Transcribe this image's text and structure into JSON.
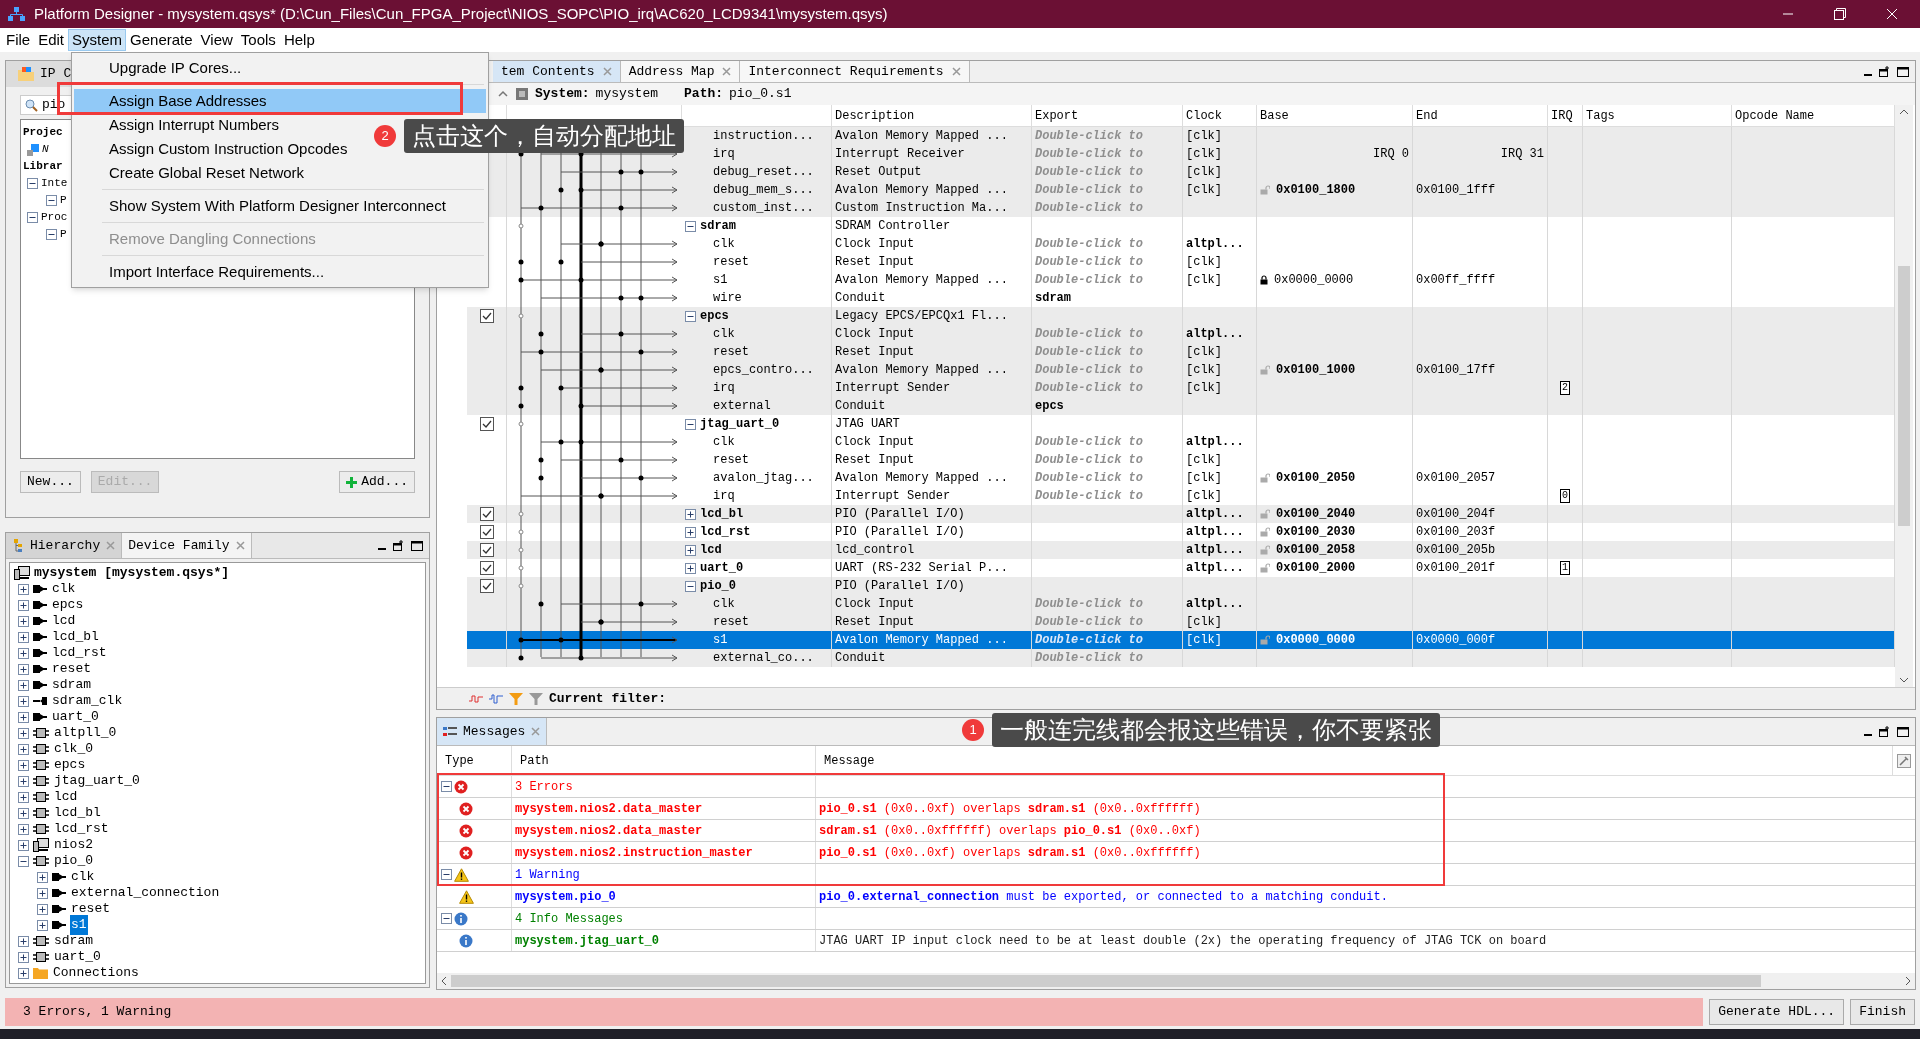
{
  "window": {
    "title": "Platform Designer - mysystem.qsys* (D:\\Cun_Files\\Cun_FPGA_Project\\NIOS_SOPC\\PIO_irq\\AC620_LCD9341\\mysystem.qsys)"
  },
  "menu_bar": [
    {
      "label": "File",
      "selected": false
    },
    {
      "label": "Edit",
      "selected": false
    },
    {
      "label": "System",
      "selected": true
    },
    {
      "label": "Generate",
      "selected": false
    },
    {
      "label": "View",
      "selected": false
    },
    {
      "label": "Tools",
      "selected": false
    },
    {
      "label": "Help",
      "selected": false
    }
  ],
  "system_menu": [
    {
      "kind": "item",
      "label": "Upgrade IP Cores...",
      "selected": false,
      "disabled": false
    },
    {
      "kind": "separator"
    },
    {
      "kind": "item",
      "label": "Assign Base Addresses",
      "selected": true,
      "disabled": false
    },
    {
      "kind": "item",
      "label": "Assign Interrupt Numbers",
      "selected": false,
      "disabled": false
    },
    {
      "kind": "item",
      "label": "Assign Custom Instruction Opcodes",
      "selected": false,
      "disabled": false
    },
    {
      "kind": "item",
      "label": "Create Global Reset Network",
      "selected": false,
      "disabled": false
    },
    {
      "kind": "separator"
    },
    {
      "kind": "item",
      "label": "Show System With Platform Designer Interconnect",
      "selected": false,
      "disabled": false
    },
    {
      "kind": "separator"
    },
    {
      "kind": "item",
      "label": "Remove Dangling Connections",
      "selected": false,
      "disabled": true
    },
    {
      "kind": "separator"
    },
    {
      "kind": "item",
      "label": "Import Interface Requirements...",
      "selected": false,
      "disabled": false
    }
  ],
  "ip_catalog": {
    "tab": "IP C",
    "search": "pio",
    "tree": [
      {
        "label": "Projec",
        "kind": "heading",
        "children": [
          {
            "label": "N",
            "kind": "component"
          }
        ]
      },
      {
        "label": "Librar",
        "kind": "heading",
        "children": [
          {
            "label": "Inte",
            "kind": "folder",
            "expanded": true,
            "children": [
              {
                "label": "P",
                "kind": "folder",
                "expanded": true
              }
            ]
          },
          {
            "label": "Proc",
            "kind": "folder",
            "expanded": true,
            "children": [
              {
                "label": "P",
                "kind": "folder",
                "expanded": true
              }
            ]
          }
        ]
      }
    ],
    "buttons": [
      {
        "label": "New...",
        "kind": "plain",
        "disabled": false
      },
      {
        "label": "Edit...",
        "kind": "plain",
        "disabled": true
      },
      {
        "label": "Add...",
        "kind": "add",
        "disabled": false
      }
    ]
  },
  "system_contents": {
    "tabs": [
      {
        "label": "tem Contents",
        "selected": true
      },
      {
        "label": "Address Map",
        "selected": false
      },
      {
        "label": "Interconnect Requirements",
        "selected": false
      }
    ],
    "path_bar": {
      "system_label": "System:",
      "system": "mysystem",
      "path_label": "Path:",
      "path": "pio_0.s1"
    },
    "columns": [
      "Description",
      "Export",
      "Clock",
      "Base",
      "End",
      "IRQ",
      "Tags",
      "Opcode Name"
    ],
    "rows": [
      {
        "kind": "port",
        "name": "instruction...",
        "description": "Avalon Memory Mapped ...",
        "export": "Double-click to",
        "export_hint": true,
        "clock": "[clk]",
        "selected": false
      },
      {
        "kind": "port",
        "name": "irq",
        "description": "Interrupt Receiver",
        "export": "Double-click to",
        "export_hint": true,
        "clock": "[clk]",
        "base": "IRQ 0",
        "end": "IRQ 31",
        "selected": false
      },
      {
        "kind": "port",
        "name": "debug_reset...",
        "description": "Reset Output",
        "export": "Double-click to",
        "export_hint": true,
        "clock": "[clk]",
        "selected": false
      },
      {
        "kind": "port",
        "name": "debug_mem_s...",
        "description": "Avalon Memory Mapped ...",
        "export": "Double-click to",
        "export_hint": true,
        "clock": "[clk]",
        "base": "0x0100_1800",
        "locked": false,
        "end": "0x0100_1fff",
        "selected": false
      },
      {
        "kind": "port",
        "name": "custom_inst...",
        "description": "Custom Instruction Ma...",
        "export": "Double-click to",
        "export_hint": true,
        "selected": false
      },
      {
        "kind": "group",
        "name": "sdram",
        "expanded": true,
        "description": "SDRAM Controller",
        "selected": false
      },
      {
        "kind": "port",
        "name": "clk",
        "description": "Clock Input",
        "export": "Double-click to",
        "export_hint": true,
        "clock": "altpl...",
        "clock_bold": true,
        "selected": false
      },
      {
        "kind": "port",
        "name": "reset",
        "description": "Reset Input",
        "export": "Double-click to",
        "export_hint": true,
        "clock": "[clk]",
        "selected": false
      },
      {
        "kind": "port",
        "name": "s1",
        "description": "Avalon Memory Mapped ...",
        "export": "Double-click to",
        "export_hint": true,
        "clock": "[clk]",
        "base": "0x0000_0000",
        "locked": true,
        "end": "0x00ff_ffff",
        "selected": false
      },
      {
        "kind": "port",
        "name": "wire",
        "description": "Conduit",
        "export": "sdram",
        "export_hint": false,
        "selected": false
      },
      {
        "kind": "group",
        "name": "epcs",
        "checked": true,
        "expanded": true,
        "description": "Legacy EPCS/EPCQx1 Fl...",
        "selected": false
      },
      {
        "kind": "port",
        "name": "clk",
        "description": "Clock Input",
        "export": "Double-click to",
        "export_hint": true,
        "clock": "altpl...",
        "clock_bold": true,
        "selected": false
      },
      {
        "kind": "port",
        "name": "reset",
        "description": "Reset Input",
        "export": "Double-click to",
        "export_hint": true,
        "clock": "[clk]",
        "selected": false
      },
      {
        "kind": "port",
        "name": "epcs_contro...",
        "description": "Avalon Memory Mapped ...",
        "export": "Double-click to",
        "export_hint": true,
        "clock": "[clk]",
        "base": "0x0100_1000",
        "locked": false,
        "end": "0x0100_17ff",
        "selected": false
      },
      {
        "kind": "port",
        "name": "irq",
        "description": "Interrupt Sender",
        "export": "Double-click to",
        "export_hint": true,
        "clock": "[clk]",
        "irq": "2",
        "selected": false
      },
      {
        "kind": "port",
        "name": "external",
        "description": "Conduit",
        "export": "epcs",
        "export_hint": false,
        "selected": false
      },
      {
        "kind": "group",
        "name": "jtag_uart_0",
        "checked": true,
        "expanded": true,
        "description": "JTAG UART",
        "selected": false
      },
      {
        "kind": "port",
        "name": "clk",
        "description": "Clock Input",
        "export": "Double-click to",
        "export_hint": true,
        "clock": "altpl...",
        "clock_bold": true,
        "selected": false
      },
      {
        "kind": "port",
        "name": "reset",
        "description": "Reset Input",
        "export": "Double-click to",
        "export_hint": true,
        "clock": "[clk]",
        "selected": false
      },
      {
        "kind": "port",
        "name": "avalon_jtag...",
        "description": "Avalon Memory Mapped ...",
        "export": "Double-click to",
        "export_hint": true,
        "clock": "[clk]",
        "base": "0x0100_2050",
        "locked": false,
        "end": "0x0100_2057",
        "selected": false
      },
      {
        "kind": "port",
        "name": "irq",
        "description": "Interrupt Sender",
        "export": "Double-click to",
        "export_hint": true,
        "clock": "[clk]",
        "irq": "0",
        "selected": false
      },
      {
        "kind": "group",
        "name": "lcd_bl",
        "checked": true,
        "expanded": false,
        "description": "PIO (Parallel I/O)",
        "clock": "altpl...",
        "clock_bold": true,
        "base": "0x0100_2040",
        "locked": false,
        "end": "0x0100_204f",
        "selected": false
      },
      {
        "kind": "group",
        "name": "lcd_rst",
        "checked": true,
        "expanded": false,
        "description": "PIO (Parallel I/O)",
        "clock": "altpl...",
        "clock_bold": true,
        "base": "0x0100_2030",
        "locked": false,
        "end": "0x0100_203f",
        "selected": false
      },
      {
        "kind": "group",
        "name": "lcd",
        "checked": true,
        "expanded": false,
        "description": "lcd_control",
        "clock": "altpl...",
        "clock_bold": true,
        "base": "0x0100_2058",
        "locked": false,
        "end": "0x0100_205b",
        "selected": false
      },
      {
        "kind": "group",
        "name": "uart_0",
        "checked": true,
        "expanded": false,
        "description": "UART (RS-232 Serial P...",
        "clock": "altpl...",
        "clock_bold": true,
        "base": "0x0100_2000",
        "locked": false,
        "end": "0x0100_201f",
        "irq": "1",
        "selected": false
      },
      {
        "kind": "group",
        "name": "pio_0",
        "checked": true,
        "expanded": true,
        "description": "PIO (Parallel I/O)",
        "selected": false
      },
      {
        "kind": "port",
        "name": "clk",
        "description": "Clock Input",
        "export": "Double-click to",
        "export_hint": true,
        "clock": "altpl...",
        "clock_bold": true,
        "selected": false
      },
      {
        "kind": "port",
        "name": "reset",
        "description": "Reset Input",
        "export": "Double-click to",
        "export_hint": true,
        "clock": "[clk]",
        "selected": false
      },
      {
        "kind": "port",
        "name": "s1",
        "description": "Avalon Memory Mapped ...",
        "export": "Double-click to",
        "export_hint": true,
        "clock": "[clk]",
        "base": "0x0000_0000",
        "locked": false,
        "end": "0x0000_000f",
        "selected": true
      },
      {
        "kind": "port",
        "name": "external_co...",
        "description": "Conduit",
        "export": "Double-click to",
        "export_hint": true,
        "selected": false
      }
    ],
    "filter_label": "Current filter:"
  },
  "hierarchy": {
    "tabs": [
      {
        "label": "Hierarchy",
        "selected": true
      },
      {
        "label": "Device Family",
        "selected": false
      }
    ],
    "root": "mysystem [mysystem.qsys*]",
    "items": [
      {
        "label": "clk",
        "kind": "export_out",
        "expanded": false,
        "selected": false
      },
      {
        "label": "epcs",
        "kind": "export_out",
        "expanded": false,
        "selected": false
      },
      {
        "label": "lcd",
        "kind": "export_out",
        "expanded": false,
        "selected": false
      },
      {
        "label": "lcd_bl",
        "kind": "export_out",
        "expanded": false,
        "selected": false
      },
      {
        "label": "lcd_rst",
        "kind": "export_out",
        "expanded": false,
        "selected": false
      },
      {
        "label": "reset",
        "kind": "export_out",
        "expanded": false,
        "selected": false
      },
      {
        "label": "sdram",
        "kind": "export_out",
        "expanded": false,
        "selected": false
      },
      {
        "label": "sdram_clk",
        "kind": "export_in",
        "expanded": false,
        "selected": false
      },
      {
        "label": "uart_0",
        "kind": "export_out",
        "expanded": false,
        "selected": false
      },
      {
        "label": "altpll_0",
        "kind": "module",
        "expanded": false,
        "selected": false
      },
      {
        "label": "clk_0",
        "kind": "module",
        "expanded": false,
        "selected": false
      },
      {
        "label": "epcs",
        "kind": "module",
        "expanded": false,
        "selected": false
      },
      {
        "label": "jtag_uart_0",
        "kind": "module",
        "expanded": false,
        "selected": false
      },
      {
        "label": "lcd",
        "kind": "module",
        "expanded": false,
        "selected": false
      },
      {
        "label": "lcd_bl",
        "kind": "module",
        "expanded": false,
        "selected": false
      },
      {
        "label": "lcd_rst",
        "kind": "module",
        "expanded": false,
        "selected": false
      },
      {
        "label": "nios2",
        "kind": "cpu",
        "expanded": false,
        "selected": false
      },
      {
        "label": "pio_0",
        "kind": "module",
        "expanded": true,
        "selected": false,
        "children": [
          {
            "label": "clk",
            "kind": "export_out",
            "expanded": false,
            "selected": false
          },
          {
            "label": "external_connection",
            "kind": "export_out",
            "expanded": false,
            "selected": false
          },
          {
            "label": "reset",
            "kind": "export_out",
            "expanded": false,
            "selected": false
          },
          {
            "label": "s1",
            "kind": "export_out",
            "expanded": false,
            "selected": true
          }
        ]
      },
      {
        "label": "sdram",
        "kind": "module",
        "expanded": false,
        "selected": false
      },
      {
        "label": "uart_0",
        "kind": "module",
        "expanded": false,
        "selected": false
      },
      {
        "label": "Connections",
        "kind": "folder",
        "expanded": false,
        "selected": false
      }
    ]
  },
  "messages": {
    "tab": "Messages",
    "columns": [
      "Type",
      "Path",
      "Message"
    ],
    "groups": [
      {
        "kind": "error",
        "text": "3 Errors",
        "expanded": true,
        "children": [
          {
            "path": "mysystem.nios2.data_master",
            "message": "**pio_0.s1** (0x0..0xf) overlaps **sdram.s1** (0x0..0xffffff)"
          },
          {
            "path": "mysystem.nios2.data_master",
            "message": "**sdram.s1** (0x0..0xffffff) overlaps **pio_0.s1** (0x0..0xf)"
          },
          {
            "path": "mysystem.nios2.instruction_master",
            "message": "**pio_0.s1** (0x0..0xf) overlaps **sdram.s1** (0x0..0xffffff)"
          }
        ]
      },
      {
        "kind": "warning",
        "text": "1 Warning",
        "expanded": true,
        "children": [
          {
            "path": "mysystem.pio_0",
            "message": "**pio_0.external_connection** must be exported, or connected to a matching conduit."
          }
        ]
      },
      {
        "kind": "info",
        "text": "4 Info Messages",
        "expanded": true,
        "children": [
          {
            "path": "mysystem.jtag_uart_0",
            "message": "JTAG UART IP input clock need to be at least double (2x) the operating frequency of JTAG TCK on board"
          }
        ]
      }
    ]
  },
  "annotations": [
    {
      "number": "2",
      "text": "点击这个，自动分配地址"
    },
    {
      "number": "1",
      "text": "一般连完线都会报这些错误，你不要紧张"
    }
  ],
  "status_bar": {
    "text": "3 Errors, 1 Warning",
    "buttons": [
      "Generate HDL...",
      "Finish"
    ]
  }
}
